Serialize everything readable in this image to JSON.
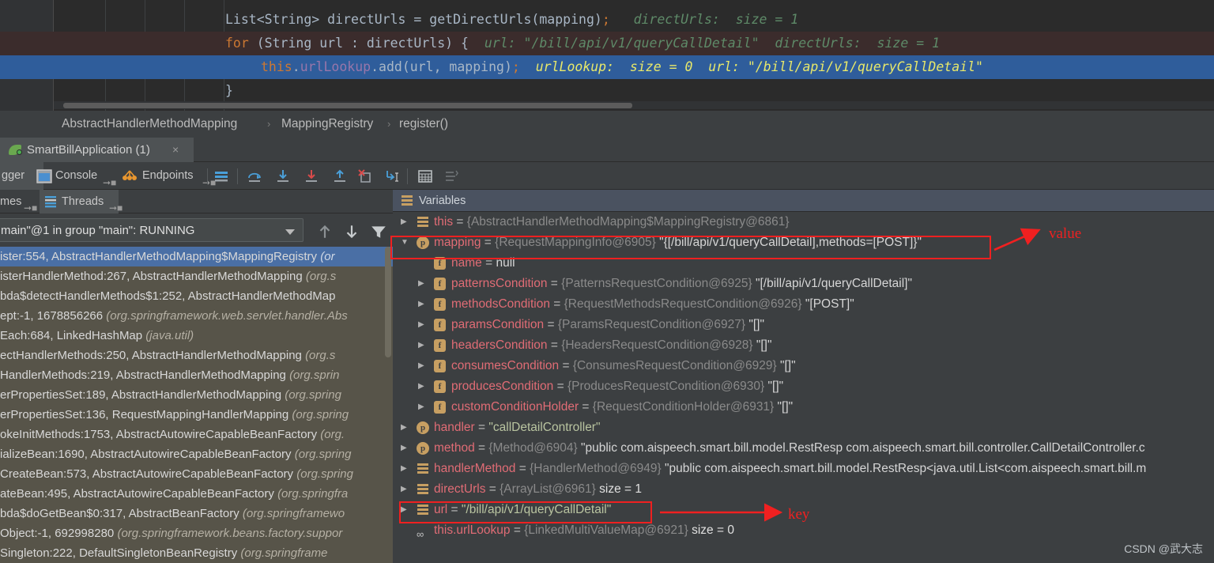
{
  "editor": {
    "lines": [
      {
        "indent": 285,
        "segments": [
          {
            "t": "List<String> directUrls = getDirectUrls(mapping)",
            "c": "tok-plain"
          },
          {
            "t": ";",
            "c": "tok-semi"
          },
          {
            "t": "   directUrls:  size = 1",
            "c": "hint"
          }
        ]
      },
      {
        "indent": 285,
        "segments": [
          {
            "t": "for",
            "c": "tok-kw"
          },
          {
            "t": " (String url : directUrls) {",
            "c": "tok-plain"
          },
          {
            "t": "  url: \"/bill/api/v1/queryCallDetail\"  directUrls:  size = 1",
            "c": "hint"
          }
        ]
      },
      {
        "indent": 330,
        "segments": [
          {
            "t": "this",
            "c": "tok-this"
          },
          {
            "t": ".",
            "c": "tok-plain"
          },
          {
            "t": "urlLookup",
            "c": "tok-field"
          },
          {
            "t": ".add(url, mapping)",
            "c": "tok-plain"
          },
          {
            "t": ";",
            "c": "tok-semi"
          },
          {
            "t": "  urlLookup:  size = 0  url: \"/bill/api/v1/queryCallDetail\"",
            "c": "hint-sel"
          }
        ]
      },
      {
        "indent": 285,
        "segments": [
          {
            "t": "}",
            "c": "tok-plain"
          }
        ]
      }
    ]
  },
  "breadcrumb": {
    "items": [
      "AbstractHandlerMethodMapping",
      "MappingRegistry",
      "register()"
    ],
    "separator": "›"
  },
  "run_tab": {
    "label": "SmartBillApplication (1)",
    "close": "×",
    "icon": "spring-leaf-icon"
  },
  "debug_toolbar": {
    "tabs": [
      {
        "label": "gger",
        "selected": true,
        "icon": "debugger-icon"
      },
      {
        "label": "Console",
        "selected": false,
        "icon": "console-icon"
      },
      {
        "label": "Endpoints",
        "selected": false,
        "icon": "endpoints-icon"
      }
    ],
    "buttons": [
      {
        "name": "show-execution-point-icon"
      },
      {
        "name": "step-over-icon"
      },
      {
        "name": "step-into-icon"
      },
      {
        "name": "force-step-into-icon"
      },
      {
        "name": "step-out-icon"
      },
      {
        "name": "drop-frame-icon"
      },
      {
        "name": "run-to-cursor-icon"
      },
      {
        "name": "evaluate-expression-icon"
      },
      {
        "name": "mute-breakpoints-icon"
      }
    ]
  },
  "frames_panel": {
    "tabs": [
      {
        "label": "mes",
        "selected": false,
        "icon": "frames-icon"
      },
      {
        "label": "Threads",
        "selected": true,
        "icon": "threads-icon"
      }
    ],
    "thread_selector": {
      "value": "main\"@1 in group \"main\": RUNNING"
    },
    "toolbar": [
      {
        "name": "frames-up-icon"
      },
      {
        "name": "frames-down-icon"
      },
      {
        "name": "frames-filter-icon"
      }
    ],
    "stack": [
      {
        "method": "ister:554, AbstractHandlerMethodMapping$MappingRegistry",
        "pkg": "(or",
        "selected": true
      },
      {
        "method": "isterHandlerMethod:267, AbstractHandlerMethodMapping",
        "pkg": "(org.s",
        "selected": false
      },
      {
        "method": "bda$detectHandlerMethods$1:252, AbstractHandlerMethodMap",
        "pkg": "",
        "selected": false
      },
      {
        "method": "ept:-1, 1678856266",
        "pkg": "(org.springframework.web.servlet.handler.Abs",
        "selected": false
      },
      {
        "method": "Each:684, LinkedHashMap",
        "pkg": "(java.util)",
        "selected": false
      },
      {
        "method": "ectHandlerMethods:250, AbstractHandlerMethodMapping",
        "pkg": "(org.s",
        "selected": false
      },
      {
        "method": "HandlerMethods:219, AbstractHandlerMethodMapping",
        "pkg": "(org.sprin",
        "selected": false
      },
      {
        "method": "erPropertiesSet:189, AbstractHandlerMethodMapping",
        "pkg": "(org.spring",
        "selected": false
      },
      {
        "method": "erPropertiesSet:136, RequestMappingHandlerMapping",
        "pkg": "(org.spring",
        "selected": false
      },
      {
        "method": "okeInitMethods:1753, AbstractAutowireCapableBeanFactory",
        "pkg": "(org.",
        "selected": false
      },
      {
        "method": "ializeBean:1690, AbstractAutowireCapableBeanFactory",
        "pkg": "(org.spring",
        "selected": false
      },
      {
        "method": "CreateBean:573, AbstractAutowireCapableBeanFactory",
        "pkg": "(org.spring",
        "selected": false
      },
      {
        "method": "ateBean:495, AbstractAutowireCapableBeanFactory",
        "pkg": "(org.springfra",
        "selected": false
      },
      {
        "method": "bda$doGetBean$0:317, AbstractBeanFactory",
        "pkg": "(org.springframewo",
        "selected": false
      },
      {
        "method": "Object:-1, 692998280",
        "pkg": "(org.springframework.beans.factory.suppor",
        "selected": false
      },
      {
        "method": "Singleton:222, DefaultSingletonBeanRegistry",
        "pkg": "(org.springframe",
        "selected": false
      }
    ]
  },
  "variables_panel": {
    "title": "Variables",
    "rows": [
      {
        "depth": 0,
        "expander": "collapsed",
        "icon": "list-icon",
        "name": "this",
        "eq": " = ",
        "type": "{AbstractHandlerMethodMapping$MappingRegistry@6861}",
        "value": "",
        "value_class": "vstr"
      },
      {
        "depth": 0,
        "expander": "expanded",
        "icon": "param-icon",
        "name": "mapping",
        "eq": " = ",
        "type": "{RequestMappingInfo@6905}",
        "value": "\"{[/bill/api/v1/queryCallDetail],methods=[POST]}\"",
        "value_class": "vval",
        "boxed": true
      },
      {
        "depth": 1,
        "expander": "none",
        "icon": "field-icon",
        "name": "name",
        "eq": " = ",
        "type": "",
        "value": "null",
        "value_class": "vnull"
      },
      {
        "depth": 1,
        "expander": "collapsed",
        "icon": "field-icon",
        "name": "patternsCondition",
        "eq": " = ",
        "type": "{PatternsRequestCondition@6925}",
        "value": "\"[/bill/api/v1/queryCallDetail]\"",
        "value_class": "vval"
      },
      {
        "depth": 1,
        "expander": "collapsed",
        "icon": "field-icon",
        "name": "methodsCondition",
        "eq": " = ",
        "type": "{RequestMethodsRequestCondition@6926}",
        "value": "\"[POST]\"",
        "value_class": "vval"
      },
      {
        "depth": 1,
        "expander": "collapsed",
        "icon": "field-icon",
        "name": "paramsCondition",
        "eq": " = ",
        "type": "{ParamsRequestCondition@6927}",
        "value": "\"[]\"",
        "value_class": "vval"
      },
      {
        "depth": 1,
        "expander": "collapsed",
        "icon": "field-icon",
        "name": "headersCondition",
        "eq": " = ",
        "type": "{HeadersRequestCondition@6928}",
        "value": "\"[]\"",
        "value_class": "vval"
      },
      {
        "depth": 1,
        "expander": "collapsed",
        "icon": "field-icon",
        "name": "consumesCondition",
        "eq": " = ",
        "type": "{ConsumesRequestCondition@6929}",
        "value": "\"[]\"",
        "value_class": "vval"
      },
      {
        "depth": 1,
        "expander": "collapsed",
        "icon": "field-icon",
        "name": "producesCondition",
        "eq": " = ",
        "type": "{ProducesRequestCondition@6930}",
        "value": "\"[]\"",
        "value_class": "vval"
      },
      {
        "depth": 1,
        "expander": "collapsed",
        "icon": "field-icon",
        "name": "customConditionHolder",
        "eq": " = ",
        "type": "{RequestConditionHolder@6931}",
        "value": "\"[]\"",
        "value_class": "vval"
      },
      {
        "depth": 0,
        "expander": "collapsed",
        "icon": "param-icon",
        "name": "handler",
        "eq": " = ",
        "type": "",
        "value": "\"callDetailController\"",
        "value_class": "vstr"
      },
      {
        "depth": 0,
        "expander": "collapsed",
        "icon": "param-icon",
        "name": "method",
        "eq": " = ",
        "type": "{Method@6904}",
        "value": "\"public com.aispeech.smart.bill.model.RestResp com.aispeech.smart.bill.controller.CallDetailController.c",
        "value_class": "vval"
      },
      {
        "depth": 0,
        "expander": "collapsed",
        "icon": "list-icon",
        "name": "handlerMethod",
        "eq": " = ",
        "type": "{HandlerMethod@6949}",
        "value": "\"public com.aispeech.smart.bill.model.RestResp<java.util.List<com.aispeech.smart.bill.m",
        "value_class": "vval"
      },
      {
        "depth": 0,
        "expander": "collapsed",
        "icon": "list-icon",
        "name": "directUrls",
        "eq": " = ",
        "type": "{ArrayList@6961}",
        "value": "size = 1",
        "value_class": "vsize"
      },
      {
        "depth": 0,
        "expander": "collapsed",
        "icon": "list-icon",
        "name": "url",
        "eq": " = ",
        "type": "",
        "value": "\"/bill/api/v1/queryCallDetail\"",
        "value_class": "vstr",
        "boxed": true
      },
      {
        "depth": 0,
        "expander": "none",
        "icon": "watch-icon",
        "name": "this.urlLookup",
        "eq": " = ",
        "type": "{LinkedMultiValueMap@6921}",
        "value": "size = 0",
        "value_class": "vsize"
      }
    ]
  },
  "annotations": {
    "value_label": "value",
    "key_label": "key",
    "color": "#f02020"
  },
  "watermark": "CSDN @武大志",
  "colors": {
    "editor_bg": "#2b2b2b",
    "panel_bg": "#3c3f41",
    "selected_line": "#2f5d9b",
    "exec_line": "#3b2c2c",
    "frames_bg": "#575449",
    "frame_selected": "#4a6fa5",
    "var_header": "#4a5260",
    "annotation_red": "#f02020",
    "var_name": "#e06c75",
    "hint_green": "#5e8a68",
    "hint_yellow": "#e8e86a"
  }
}
